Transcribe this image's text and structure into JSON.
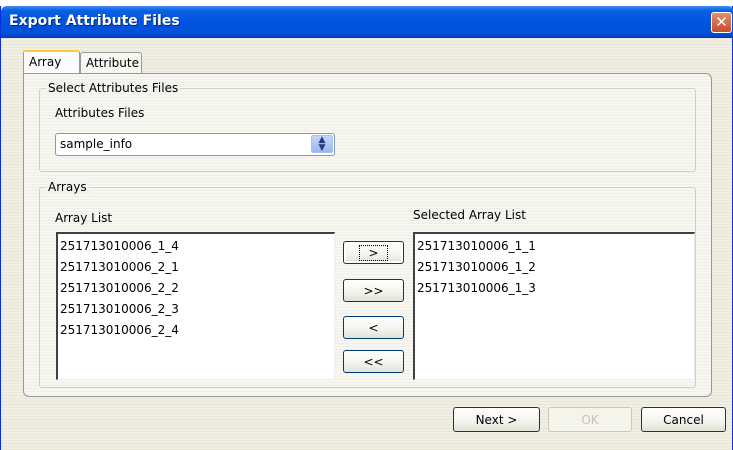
{
  "window": {
    "title": "Export Attribute Files"
  },
  "tabs": [
    {
      "label": "Array",
      "active": true
    },
    {
      "label": "Attribute",
      "active": false
    }
  ],
  "select_group": {
    "legend": "Select Attributes Files",
    "field_label": "Attributes Files",
    "selected_value": "sample_info"
  },
  "arrays_group": {
    "legend": "Arrays",
    "array_list_label": "Array List",
    "selected_list_label": "Selected Array List",
    "array_list": [
      "251713010006_1_4",
      "251713010006_2_1",
      "251713010006_2_2",
      "251713010006_2_3",
      "251713010006_2_4"
    ],
    "selected_list": [
      "251713010006_1_1",
      "251713010006_1_2",
      "251713010006_1_3"
    ],
    "buttons": {
      "add": ">",
      "add_all": ">>",
      "remove": "<",
      "remove_all": "<<"
    }
  },
  "footer": {
    "next_label": "Next >",
    "ok_label": "OK",
    "cancel_label": "Cancel"
  },
  "colors": {
    "titlebar": "#0054e3",
    "close": "#c94b2b",
    "tab_accent": "#ffc83c",
    "panel_border": "#919b9c"
  }
}
